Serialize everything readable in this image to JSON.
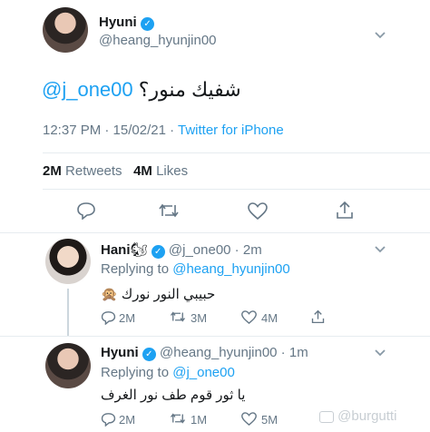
{
  "main_tweet": {
    "display_name": "Hyuni",
    "handle": "@heang_hyunjin00",
    "mention": "@j_one00",
    "text": "شفيك منور؟",
    "timestamp": "12:37 PM · 15/02/21 · ",
    "client": "Twitter for iPhone",
    "retweets_value": "2M",
    "retweets_label": "Retweets",
    "likes_value": "4M",
    "likes_label": "Likes"
  },
  "reply1": {
    "display_name": "Hani",
    "emoji": "🐿",
    "handle": "@j_one00 · 2m",
    "replying_prefix": "Replying to ",
    "replying_to": "@heang_hyunjin00",
    "text": "حبيبي النور نورك 🙊",
    "replies": "2M",
    "retweets": "3M",
    "likes": "4M"
  },
  "reply2": {
    "display_name": "Hyuni",
    "handle": "@heang_hyunjin00 · 1m",
    "replying_prefix": "Replying to ",
    "replying_to": "@j_one00",
    "text": "يا ثور قوم طف نور الغرف",
    "replies": "2M",
    "retweets": "1M",
    "likes": "5M"
  },
  "watermark": "@burgutti",
  "colors": {
    "accent": "#1da1f2",
    "text": "#14171a",
    "muted": "#657786",
    "divider": "#e6ecf0"
  }
}
